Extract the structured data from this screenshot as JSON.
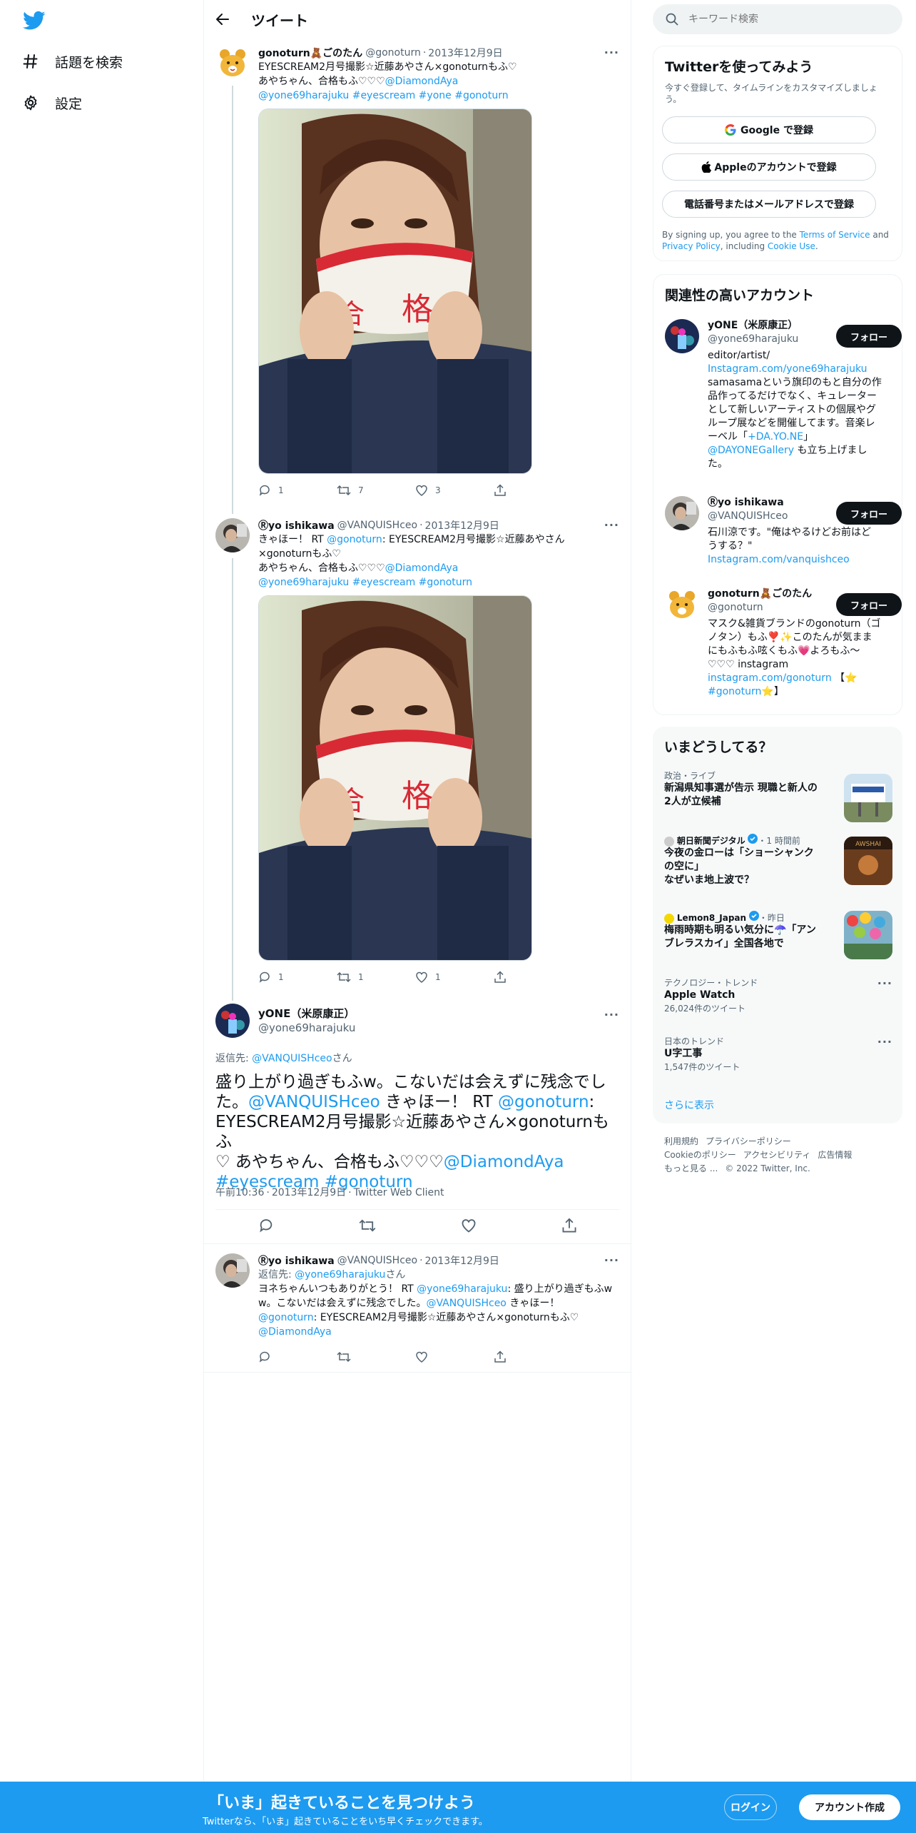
{
  "nav": {
    "items": [
      {
        "label": "話題を検索",
        "icon": "hashtag-icon"
      },
      {
        "label": "設定",
        "icon": "gear-icon"
      }
    ]
  },
  "header": {
    "title": "ツイート"
  },
  "tweets": [
    {
      "name": "gonoturn🧸ごのたん",
      "handle": "@gonoturn",
      "date": "2013年12月9日",
      "lines": [
        [
          {
            "t": "EYESCREAM2月号撮影☆近藤あやさん×gonoturnもふ♡"
          }
        ],
        [
          {
            "t": "あやちゃん、合格もふ♡♡♡"
          },
          {
            "t": "@DiamondAya",
            "link": true
          }
        ],
        [
          {
            "t": "@yone69harajuku",
            "link": true
          },
          {
            "t": "#eyescream",
            "link": true
          },
          {
            "t": "#yone",
            "link": true
          },
          {
            "t": " #gonoturn",
            "link": true
          }
        ]
      ],
      "replies": "1",
      "retweets": "7",
      "likes": "3"
    },
    {
      "name": "Ⓡyo ishikawa",
      "handle": "@VANQUISHceo",
      "date": "2013年12月9日",
      "lines": [
        [
          {
            "t": "きゃほー！ RT "
          },
          {
            "t": "@gonoturn",
            "link": true
          },
          {
            "t": ": EYESCREAM2月号撮影☆近藤あやさん"
          }
        ],
        [
          {
            "t": "×gonoturnもふ♡"
          }
        ],
        [
          {
            "t": "あやちゃん、合格もふ♡♡♡"
          },
          {
            "t": "@DiamondAya",
            "link": true
          }
        ],
        [
          {
            "t": "@yone69harajuku",
            "link": true
          },
          {
            "t": "#eyescream",
            "link": true
          },
          {
            "t": " #gonoturn",
            "link": true
          }
        ]
      ],
      "replies": "1",
      "retweets": "1",
      "likes": "1"
    },
    {
      "name": "Ⓡyo ishikawa",
      "handle": "@VANQUISHceo",
      "date": "2013年12月9日",
      "reply_prefix": "返信先: ",
      "reply_to": "@yone69harajuku",
      "reply_suffix": "さん",
      "lines": [
        [
          {
            "t": "ヨネちゃんいつもありがとう！ RT "
          },
          {
            "t": "@yone69harajuku",
            "link": true
          },
          {
            "t": ": 盛り上がり過ぎもふw"
          }
        ],
        [
          {
            "t": "w。こないだは会えずに残念でした。"
          },
          {
            "t": "@VANQUISHceo",
            "link": true
          },
          {
            "t": " きゃほー！"
          }
        ],
        [
          {
            "t": "@gonoturn",
            "link": true
          },
          {
            "t": ": EYESCREAM2月号撮影☆近藤あやさん×gonoturnもふ♡"
          }
        ],
        [
          {
            "t": "@DiamondAya",
            "link": true
          }
        ]
      ]
    }
  ],
  "focus": {
    "name": "yONE（米原康正）",
    "handle": "@yone69harajuku",
    "reply_prefix": "返信先: ",
    "reply_to": "@VANQUISHceo",
    "reply_suffix": "さん",
    "lines": [
      [
        {
          "t": "盛り上がり過ぎもふw。こないだは会えずに残念でし"
        }
      ],
      [
        {
          "t": "た。"
        },
        {
          "t": "@VANQUISHceo",
          "link": true
        },
        {
          "t": " きゃほー！ RT "
        },
        {
          "t": "@gonoturn",
          "link": true
        },
        {
          "t": ":"
        }
      ],
      [
        {
          "t": "EYESCREAM2月号撮影☆近藤あやさん×gonoturnもふ"
        }
      ],
      [
        {
          "t": "♡ あやちゃん、合格もふ♡♡♡"
        },
        {
          "t": "@DiamondAya",
          "link": true
        }
      ],
      [
        {
          "t": "#eyescream",
          "link": true
        },
        {
          "t": " #gonoturn",
          "link": true
        }
      ]
    ],
    "time": "午前10:36",
    "date": "2013年12月9日",
    "client": "Twitter Web Client"
  },
  "search": {
    "placeholder": "キーワード検索"
  },
  "signup": {
    "title": "Twitterを使ってみよう",
    "subtitle": "今すぐ登録して、タイムラインをカスタマイズしましょう。",
    "google": "Google で登録",
    "apple": "Appleのアカウントで登録",
    "phone": "電話番号またはメールアドレスで登録",
    "legal_1": "By signing up, you agree to the ",
    "terms": "Terms of Service",
    "legal_2": " and ",
    "privacy": "Privacy Policy",
    "legal_3": ", including ",
    "cookie": "Cookie Use",
    "legal_4": "."
  },
  "relevant": {
    "title": "関連性の高いアカウント",
    "follow_label": "フォロー",
    "accounts": [
      {
        "name": "yONE（米原康正）",
        "handle": "@yone69harajuku",
        "bio": [
          [
            {
              "t": "editor/artist/"
            }
          ],
          [
            {
              "t": "Instagram.com/yone69harajuku",
              "link": true
            }
          ],
          [
            {
              "t": "samasamaという旗印のもと自分の作"
            }
          ],
          [
            {
              "t": "品作ってるだけでなく、キュレーター"
            }
          ],
          [
            {
              "t": "として新しいアーティストの個展やグ"
            }
          ],
          [
            {
              "t": "ループ展などを開催してます。音楽レ"
            }
          ],
          [
            {
              "t": "ーベル「"
            },
            {
              "t": "+DA.YO.NE",
              "link": true
            },
            {
              "t": "」"
            }
          ],
          [
            {
              "t": "@DAYONEGallery",
              "link": true
            },
            {
              "t": " も立ち上げまし"
            }
          ],
          [
            {
              "t": "た。"
            }
          ]
        ]
      },
      {
        "name": "Ⓡyo ishikawa",
        "handle": "@VANQUISHceo",
        "bio": [
          [
            {
              "t": "石川涼です。\"俺はやるけどお前はど"
            }
          ],
          [
            {
              "t": "うする？\""
            }
          ],
          [
            {
              "t": "Instagram.com/vanquishceo",
              "link": true
            }
          ]
        ]
      },
      {
        "name": "gonoturn🧸ごのたん",
        "handle": "@gonoturn",
        "bio": [
          [
            {
              "t": "マスク&雑貨ブランドのgonoturn（ゴ"
            }
          ],
          [
            {
              "t": "ノタン）もふ❣️✨このたんが気まま"
            }
          ],
          [
            {
              "t": "にもふもふ呟くもふ💗よろもふ〜"
            }
          ],
          [
            {
              "t": "♡♡♡ instagram"
            }
          ],
          [
            {
              "t": "instagram.com/gonoturn",
              "link": true
            },
            {
              "t": " 【⭐"
            }
          ],
          [
            {
              "t": "#gonoturn⭐",
              "link": true
            },
            {
              "t": "】"
            }
          ]
        ]
      }
    ]
  },
  "trends": {
    "title": "いまどうしてる？",
    "items": [
      {
        "meta": "政治・ライブ",
        "lines": [
          "新潟県知事選が告示 現職と新人の",
          "2人が立候補"
        ],
        "thumb": true
      },
      {
        "source": "朝日新聞デジタル",
        "meta": "・1 時間前",
        "lines": [
          "今夜の金ローは「ショーシャンク",
          "の空に」",
          "なぜいま地上波で？"
        ],
        "thumb": true,
        "verified": true
      },
      {
        "source": "Lemon8_Japan",
        "meta": "・昨日",
        "lines": [
          "梅雨時期も明るい気分に☂️「アン",
          "ブレラスカイ」全国各地で"
        ],
        "thumb": true,
        "verified": true
      },
      {
        "meta": "テクノロジー・トレンド",
        "lines": [
          "Apple Watch"
        ],
        "count": "26,024件のツイート"
      },
      {
        "meta": "日本のトレンド",
        "lines": [
          "U字工事"
        ],
        "count": "1,547件のツイート"
      }
    ],
    "show_more": "さらに表示"
  },
  "footer": {
    "row1": [
      "利用規約",
      "プライバシーポリシー"
    ],
    "row2": [
      "Cookieのポリシー",
      "アクセシビリティ",
      "広告情報"
    ],
    "row3": [
      "もっと見る ...",
      "© 2022 Twitter, Inc."
    ]
  },
  "bottom_bar": {
    "title": "「いま」起きていることを見つけよう",
    "subtitle": "Twitterなら、「いま」起きていることをいち早くチェックできます。",
    "login": "ログイン",
    "signup": "アカウント作成"
  },
  "colors": {
    "accent": "#1d9bf0",
    "text": "#0f1419",
    "muted": "#536471",
    "border": "#eff3f4"
  }
}
